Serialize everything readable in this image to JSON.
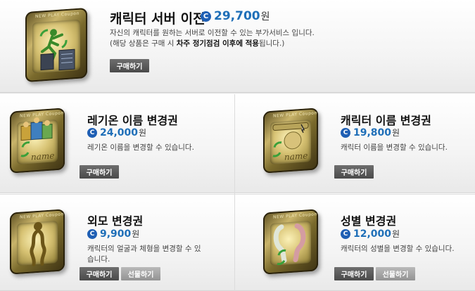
{
  "products": {
    "server_transfer": {
      "title": "캐릭터 서버 이전",
      "coin_symbol": "C",
      "price": "29,700",
      "unit": "원",
      "desc_line1": "자신의 캐릭터를 원하는 서버로 이전할 수 있는 부가서비스 입니다.",
      "desc_line2_pre": "(해당 상품은 구매 시 ",
      "desc_line2_bold": "차주 정기점검 이후에 적용",
      "desc_line2_post": "됩니다.)",
      "buy_label": "구매하기",
      "card_text": "NEW PLAY Coupon"
    },
    "legion_rename": {
      "title": "레기온 이름 변경권",
      "coin_symbol": "C",
      "price": "24,000",
      "unit": "원",
      "desc": "레기온 이름을 변경할 수 있습니다.",
      "buy_label": "구매하기",
      "card_text": "NEW PLAY Coupon",
      "card_word": "name"
    },
    "character_rename": {
      "title": "캐릭터 이름 변경권",
      "coin_symbol": "C",
      "price": "19,800",
      "unit": "원",
      "desc": "캐릭터 이름을 변경할 수 있습니다.",
      "buy_label": "구매하기",
      "card_text": "NEW PLAY Coupon",
      "card_word": "name"
    },
    "appearance": {
      "title": "외모 변경권",
      "coin_symbol": "C",
      "price": "9,900",
      "unit": "원",
      "desc": "캐릭터의 얼굴과 체형을 변경할 수 있습니다.",
      "buy_label": "구매하기",
      "gift_label": "선물하기",
      "card_text": "NEW PLAY Coupon"
    },
    "gender": {
      "title": "성별 변경권",
      "coin_symbol": "C",
      "price": "12,000",
      "unit": "원",
      "desc": "캐릭터의 성별을 변경할 수 있습니다.",
      "buy_label": "구매하기",
      "gift_label": "선물하기",
      "card_text": "NEW PLAY Coupon"
    }
  },
  "colors": {
    "price_blue": "#1f6fb8",
    "coin_blue": "#1f5fb4",
    "button_dark": "#555555",
    "button_gray": "#a3a3a3"
  }
}
